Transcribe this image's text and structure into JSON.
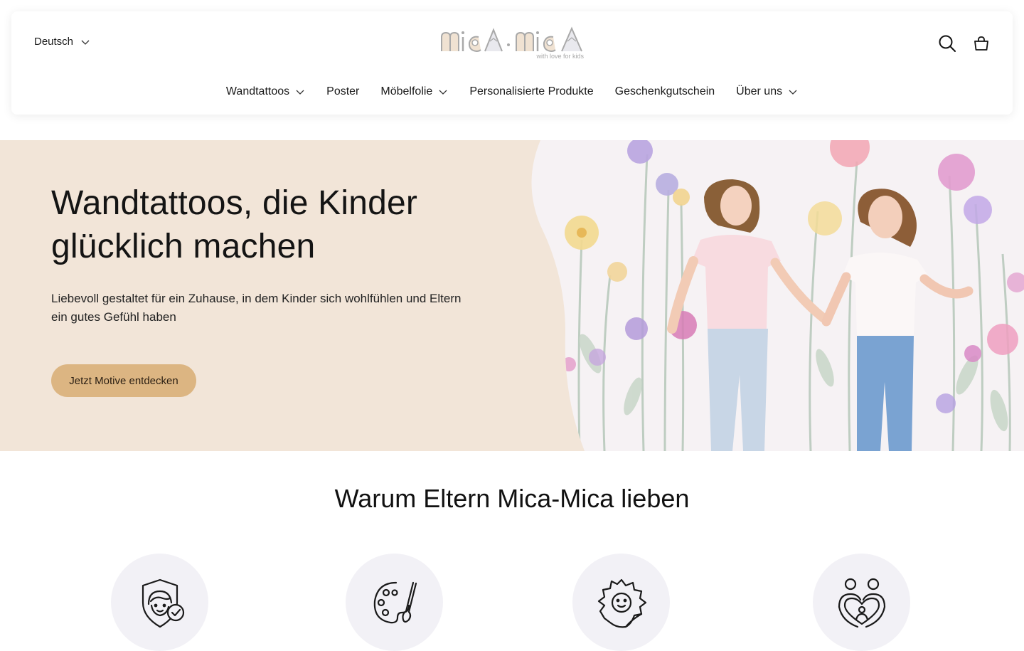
{
  "header": {
    "language": "Deutsch",
    "logo": {
      "text": "mica·mica",
      "tagline": "with love for kids"
    },
    "icons": {
      "search": "search-icon",
      "cart": "cart-icon",
      "chevron": "chevron-down-icon"
    }
  },
  "nav": {
    "items": [
      {
        "label": "Wandtattoos",
        "has_dropdown": true
      },
      {
        "label": "Poster",
        "has_dropdown": false
      },
      {
        "label": "Möbelfolie",
        "has_dropdown": true
      },
      {
        "label": "Personalisierte Produkte",
        "has_dropdown": false
      },
      {
        "label": "Geschenkgutschein",
        "has_dropdown": false
      },
      {
        "label": "Über uns",
        "has_dropdown": true
      }
    ]
  },
  "hero": {
    "title": "Wandtattoos, die Kinder glücklich machen",
    "subtitle": "Liebevoll gestaltet für ein Zuhause, in dem Kinder sich wohlfühlen und Eltern ein gutes Gefühl haben",
    "cta": "Jetzt Motive entdecken"
  },
  "why": {
    "title": "Warum Eltern Mica-Mica lieben",
    "features": [
      {
        "icon": "child-safety-shield-icon"
      },
      {
        "icon": "palette-brush-icon"
      },
      {
        "icon": "sun-sticker-icon"
      },
      {
        "icon": "family-heart-icon"
      }
    ]
  },
  "colors": {
    "hero_bg": "#f2e5d8",
    "cta_bg": "#dcb582",
    "feature_bg": "#f2f1f6"
  }
}
